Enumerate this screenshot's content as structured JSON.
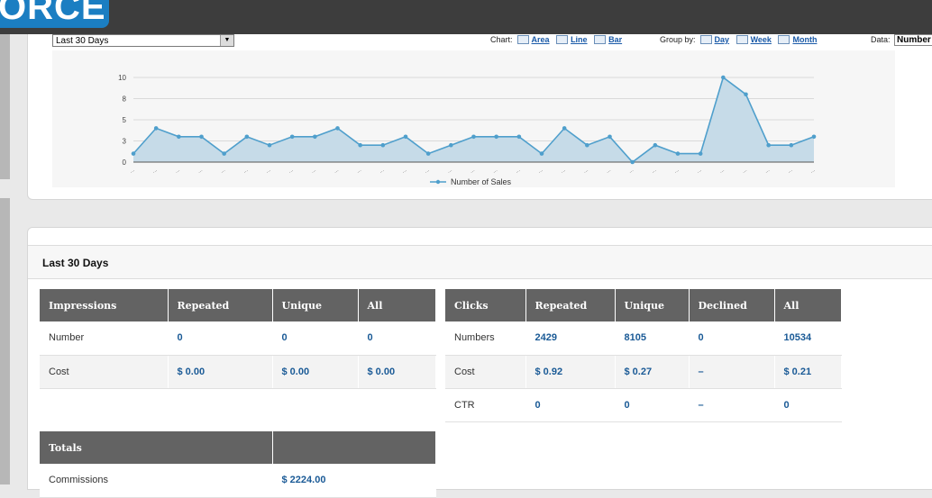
{
  "header": {
    "logo_text": "ORCE"
  },
  "period_select": {
    "value": "Last 30 Days"
  },
  "chart_controls": {
    "chart_label": "Chart:",
    "chart_types": [
      "Area",
      "Line",
      "Bar"
    ],
    "group_label": "Group by:",
    "group_options": [
      "Day",
      "Week",
      "Month"
    ],
    "data_label": "Data:",
    "data_value": "Number"
  },
  "chart_data": {
    "type": "area",
    "title": "",
    "xlabel": "",
    "ylabel": "",
    "ylim": [
      0,
      10
    ],
    "y_ticks": [
      "0",
      "3",
      "5",
      "8",
      "10"
    ],
    "x_tick_label": "...",
    "grid": true,
    "legend_position": "bottom-center",
    "colors": {
      "line": "#4f9fcc",
      "fill": "#c6dbe8"
    },
    "series": [
      {
        "name": "Number of Sales",
        "values": [
          1,
          4,
          3,
          3,
          1,
          3,
          2,
          3,
          3,
          4,
          2,
          2,
          3,
          1,
          2,
          3,
          3,
          3,
          1,
          4,
          2,
          3,
          0,
          2,
          1,
          1,
          10,
          8,
          2,
          2,
          3
        ]
      }
    ]
  },
  "section": {
    "title": "Last 30 Days"
  },
  "impressions_table": {
    "headers": [
      "Impressions",
      "Repeated",
      "Unique",
      "All"
    ],
    "rows": [
      [
        "Number",
        "0",
        "0",
        "0"
      ],
      [
        "Cost",
        "$ 0.00",
        "$ 0.00",
        "$ 0.00"
      ]
    ]
  },
  "clicks_table": {
    "headers": [
      "Clicks",
      "Repeated",
      "Unique",
      "Declined",
      "All"
    ],
    "rows": [
      [
        "Numbers",
        "2429",
        "8105",
        "0",
        "10534"
      ],
      [
        "Cost",
        "$ 0.92",
        "$ 0.27",
        "–",
        "$ 0.21"
      ],
      [
        "CTR",
        "0",
        "0",
        "–",
        "0"
      ]
    ]
  },
  "totals_table": {
    "headers": [
      "Totals",
      ""
    ],
    "rows": [
      [
        "Commissions",
        "$ 2224.00"
      ]
    ]
  }
}
